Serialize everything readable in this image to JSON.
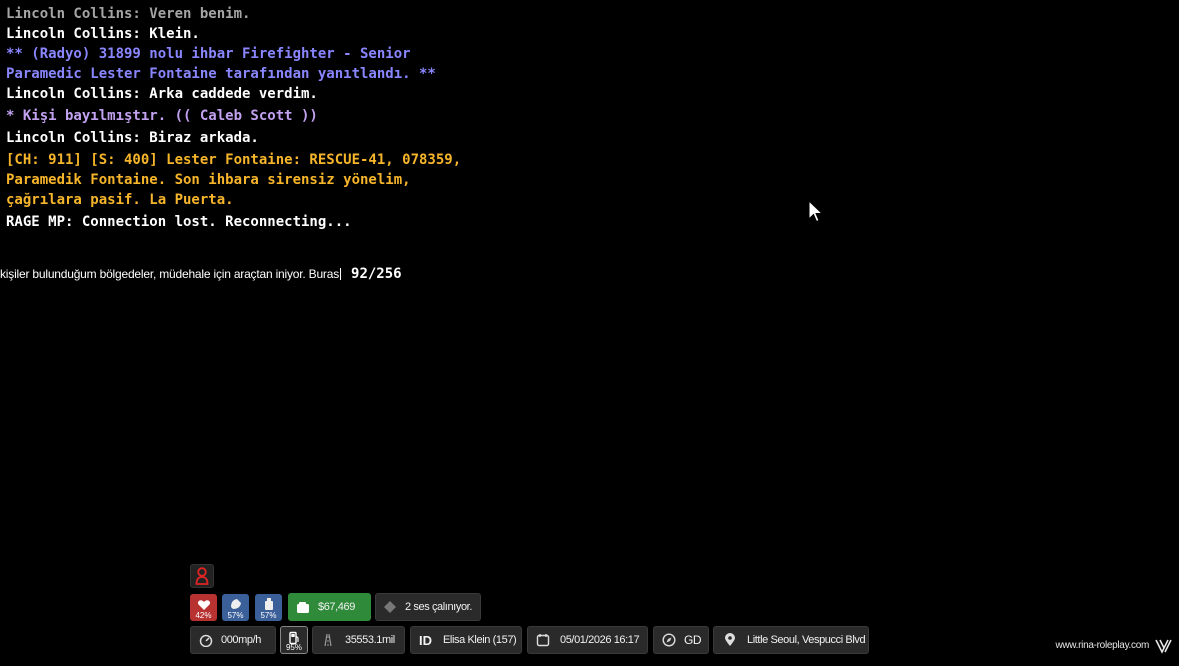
{
  "chat": {
    "cutoff_line": "Lincoln Collins: Klein.",
    "lines": [
      {
        "text": "Lincoln Collins: Veren benim.",
        "color": "gray"
      },
      {
        "text": "Lincoln Collins: Klein.",
        "color": "white"
      },
      {
        "text": "** (Radyo) 31899 nolu ihbar Firefighter - Senior Paramedic Lester Fontaine tarafından yanıtlandı. **",
        "color": "blue"
      },
      {
        "text": "Lincoln Collins: Arka caddede verdim.",
        "color": "white"
      },
      {
        "text": "* Kişi bayılmıştır. (( Caleb Scott ))",
        "color": "purple"
      },
      {
        "text": "Lincoln Collins: Biraz arkada.",
        "color": "white"
      },
      {
        "text": "[CH: 911] [S: 400] Lester Fontaine: RESCUE-41, 078359, Paramedik Fontaine. Son ihbara sirensiz yönelim, çağrılara pasif. La Puerta.",
        "color": "orange"
      },
      {
        "text": "RAGE MP: Connection lost. Reconnecting...",
        "color": "white"
      }
    ]
  },
  "input": {
    "value": "kişiler bulunduğum bölgedeler, müdehale için araçtan iniyor. Buras",
    "char_count": "92/256"
  },
  "hud": {
    "health_pct": "42%",
    "hunger_pct": "57%",
    "thirst_pct": "57%",
    "money": "$67,469",
    "voice_status": "2 ses çalınıyor.",
    "speed": "000mp/h",
    "fuel_pct": "95%",
    "odometer": "35553.1mil",
    "id_label": "ID",
    "player": "Elisa Klein (157)",
    "datetime": "05/01/2026 16:17",
    "heading": "GD",
    "location": "Little Seoul, Vespucci Blvd"
  },
  "watermark": "www.rina-roleplay.com",
  "colors": {
    "gray": "#cfcfcf",
    "white": "#ffffff",
    "blue": "#8a86ff",
    "purple": "#c2a2f0",
    "orange": "#f6b52a",
    "money_green": "#2f8a3a",
    "health_red": "#b83232",
    "hunger_blue": "#3b5f99",
    "thirst_blue": "#3b5f99"
  },
  "icons": {
    "wanted": "person-red-icon",
    "health": "heart-icon",
    "hunger": "food-icon",
    "thirst": "bottle-icon",
    "money": "wallet-icon",
    "voice": "diamond-icon",
    "speed": "speedometer-icon",
    "fuel": "fuel-pump-icon",
    "odometer": "road-icon",
    "calendar": "calendar-icon",
    "compass": "compass-icon",
    "location": "map-pin-icon",
    "cursor": "mouse-cursor-icon"
  }
}
